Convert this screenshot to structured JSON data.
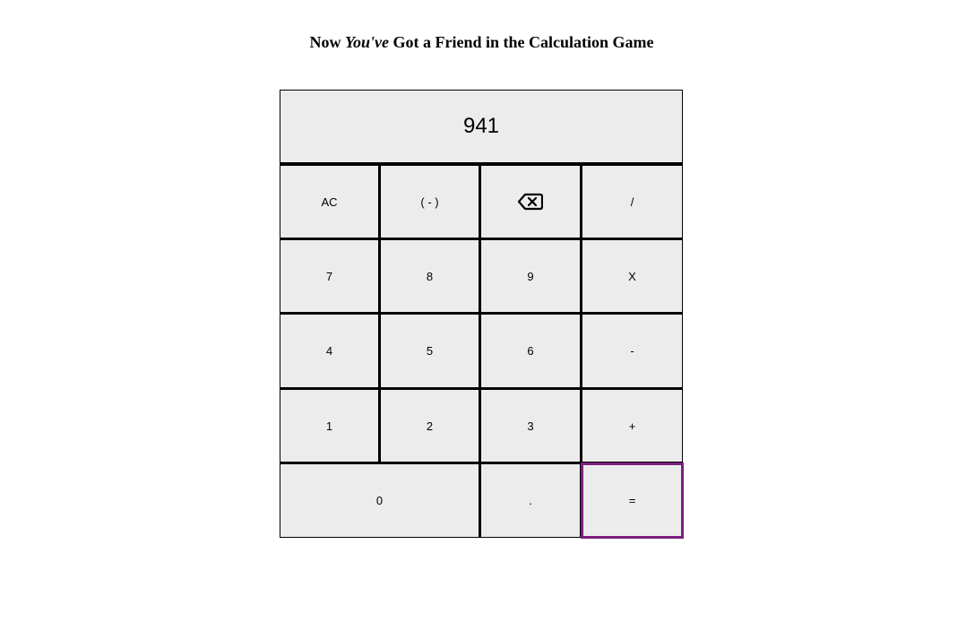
{
  "title": {
    "before": "Now ",
    "emphasis": "You've",
    "after": " Got a Friend in the Calculation Game"
  },
  "display": {
    "value": "941"
  },
  "keys": {
    "ac": "AC",
    "negate": "( - )",
    "backspace_icon": "backspace-icon",
    "divide": "/",
    "seven": "7",
    "eight": "8",
    "nine": "9",
    "multiply": "X",
    "four": "4",
    "five": "5",
    "six": "6",
    "minus": "-",
    "one": "1",
    "two": "2",
    "three": "3",
    "plus": "+",
    "zero": "0",
    "decimal": ".",
    "equals": "="
  },
  "colors": {
    "key_background": "#ececec",
    "focus_outline": "#7b1f7f"
  }
}
